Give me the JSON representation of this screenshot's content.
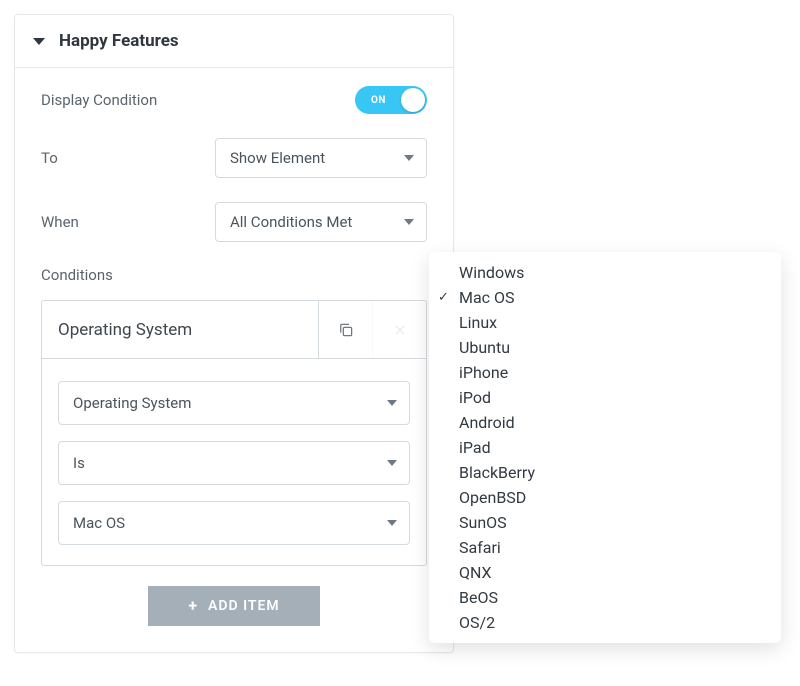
{
  "header": {
    "title": "Happy Features"
  },
  "displayCondition": {
    "label": "Display Condition",
    "toggleText": "ON",
    "enabled": true
  },
  "to": {
    "label": "To",
    "value": "Show Element"
  },
  "when": {
    "label": "When",
    "value": "All Conditions Met"
  },
  "conditionsLabel": "Conditions",
  "condition": {
    "title": "Operating System",
    "keySelect": "Operating System",
    "operatorSelect": "Is",
    "valueSelect": "Mac OS"
  },
  "addItemLabel": "ADD ITEM",
  "options": [
    {
      "label": "Windows",
      "selected": false
    },
    {
      "label": "Mac OS",
      "selected": true
    },
    {
      "label": "Linux",
      "selected": false
    },
    {
      "label": "Ubuntu",
      "selected": false
    },
    {
      "label": "iPhone",
      "selected": false
    },
    {
      "label": "iPod",
      "selected": false
    },
    {
      "label": "Android",
      "selected": false
    },
    {
      "label": "iPad",
      "selected": false
    },
    {
      "label": "BlackBerry",
      "selected": false
    },
    {
      "label": "OpenBSD",
      "selected": false
    },
    {
      "label": "SunOS",
      "selected": false
    },
    {
      "label": "Safari",
      "selected": false
    },
    {
      "label": "QNX",
      "selected": false
    },
    {
      "label": "BeOS",
      "selected": false
    },
    {
      "label": "OS/2",
      "selected": false
    }
  ]
}
